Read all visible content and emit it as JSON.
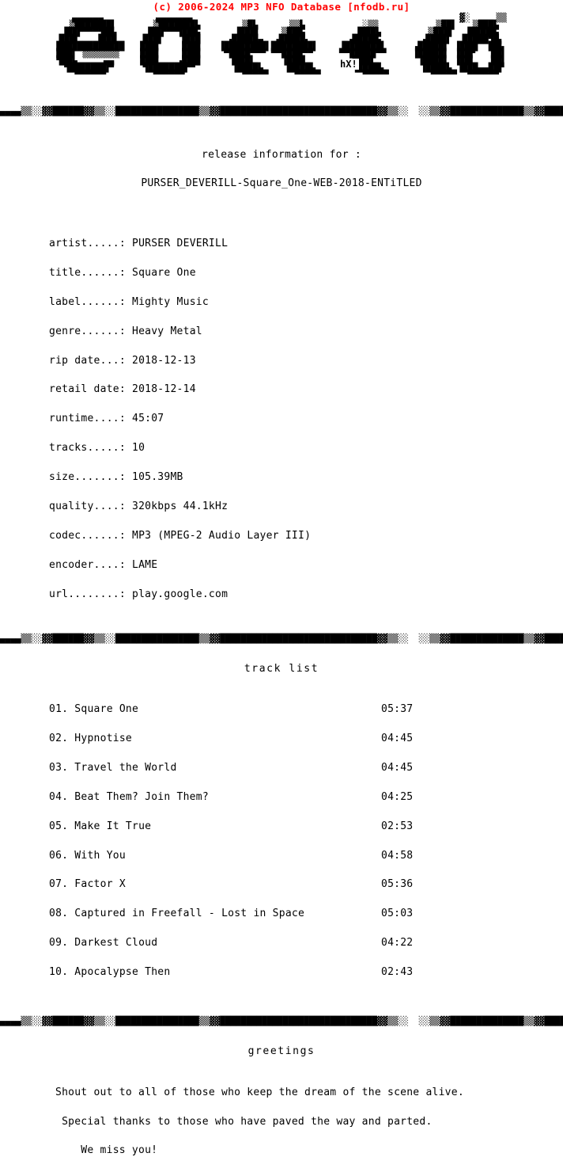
{
  "banner": {
    "text": "(c) 2006-2024 MP3 NFO Database [nfodb.ru]",
    "color": "#ff0000"
  },
  "logo": {
    "group_name": "entitled",
    "signature": "hX!",
    "art": "   ▄▄▄▄▄▄          ▄▄▄▄▄▄▄                                                   ▓░     ▒▒\n ▒███████▌       ▒███████▙        ▒█▙      ▒▒▙           ░▒▒           ▒██▌   ▒███▙\n▐██▛▀▀▀▜██▖     ▐██▛▀▀▜███▖      ▐███▌    ▒███▖         ▐███▙         ▒███▌  ▐█████▖\n███▌   ▐███     ███▌   ▐███     ▗█████▄  ▗█████▖       ▗█████▖       ▗████▌  █████▜█▖\n█████████████   ███▌    ███▌   ▐████████▌████████▌    ▐███████▌     ▗█████▌ ▐███▌ ▐██▖\n███▌ ▒▒▒▒▒▒▒    ███▌    ███▌    ▀████▀▀▀ ▀▀████▀▀     ▀▀█████▀▀     ▐█████▌ ▐██▛   ██▌\n▜██▙     ▄▄     ███▌   ▗███▌     ▐███▌     ▐███▌        ▐███▌        ▐████▌ ▐██▌   ██▌\n ▜███████▛▘     ▜███████▛▀       ▐████▙    ▐████▙       ▐████▙       ▐████▙ ▐███▄▄██▛\n  ▀▀▀▀▀▀         ▀▀▀▀▀▀           ▀▀▀▀▀     ▀▀▀▀▀        ▀▀▀▀▀        ▀▀▀▀▀  ▀▀▀▀▀▀"
  },
  "separator": {
    "bar": "▄▄▄▄▒▒░░▓▓██████▓▓▒▒░░████████████████▒▒▓▓██████████████████████████████▓▓▒▒░░  ░░▒▒▓▓██████████████▒▒▓▓████████▓▓▒▒░░▄▄▄▄",
    "rail_left": "░▒▓█",
    "rail_right": "█▓▒░"
  },
  "release_header": {
    "line1": "release information for :",
    "line2": "PURSER_DEVERILL-Square_One-WEB-2018-ENTiTLED"
  },
  "info": {
    "fields": [
      {
        "label": "artist.....:",
        "value": "PURSER DEVERILL"
      },
      {
        "label": "title......:",
        "value": "Square One"
      },
      {
        "label": "label......:",
        "value": "Mighty Music"
      },
      {
        "label": "genre......:",
        "value": "Heavy Metal"
      },
      {
        "label": "rip date...:",
        "value": "2018-12-13"
      },
      {
        "label": "retail date:",
        "value": "2018-12-14"
      },
      {
        "label": "runtime....:",
        "value": "45:07"
      },
      {
        "label": "tracks.....:",
        "value": "10"
      },
      {
        "label": "size.......:",
        "value": "105.39MB"
      },
      {
        "label": "quality....:",
        "value": "320kbps 44.1kHz"
      },
      {
        "label": "codec......:",
        "value": "MP3 (MPEG-2 Audio Layer III)"
      },
      {
        "label": "encoder....:",
        "value": "LAME"
      },
      {
        "label": "url........:",
        "value": "play.google.com"
      }
    ]
  },
  "tracklist": {
    "caption": "track list",
    "tracks": [
      {
        "num": "01.",
        "title": "Square One",
        "time": "05:37"
      },
      {
        "num": "02.",
        "title": "Hypnotise",
        "time": "04:45"
      },
      {
        "num": "03.",
        "title": "Travel the World",
        "time": "04:45"
      },
      {
        "num": "04.",
        "title": "Beat Them? Join Them?",
        "time": "04:25"
      },
      {
        "num": "05.",
        "title": "Make It True",
        "time": "02:53"
      },
      {
        "num": "06.",
        "title": "With You",
        "time": "04:58"
      },
      {
        "num": "07.",
        "title": "Factor X",
        "time": "05:36"
      },
      {
        "num": "08.",
        "title": "Captured in Freefall - Lost in Space",
        "time": "05:03"
      },
      {
        "num": "09.",
        "title": "Darkest Cloud",
        "time": "04:22"
      },
      {
        "num": "10.",
        "title": "Apocalypse Then",
        "time": "02:43"
      }
    ]
  },
  "greetings": {
    "caption": "greetings",
    "lines": [
      "Shout out to all of those who keep the dream of the scene alive.",
      " Special thanks to those who have paved the way and parted.",
      "    We miss you!"
    ]
  }
}
